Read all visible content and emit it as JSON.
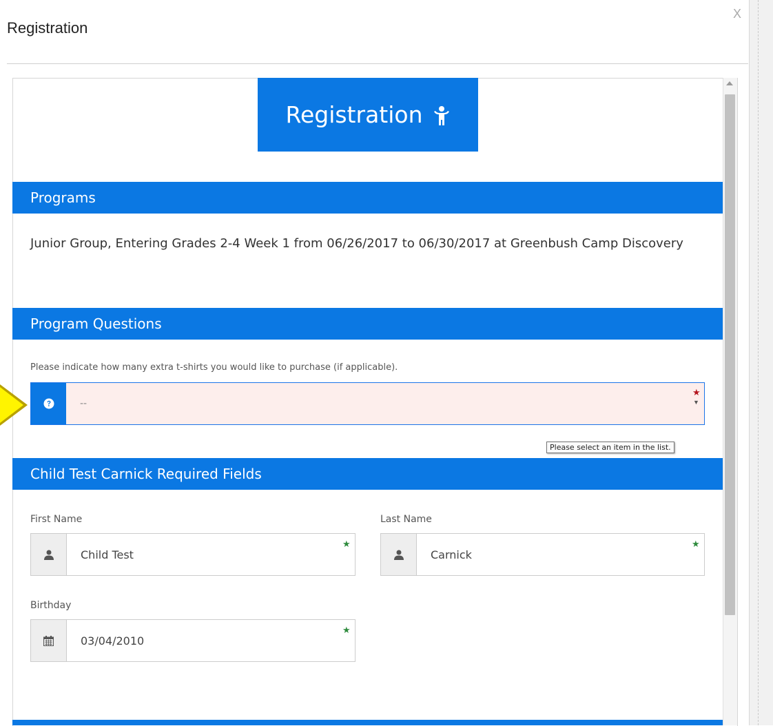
{
  "modal": {
    "title": "Registration",
    "close_label": "X"
  },
  "banner": {
    "title": "Registration",
    "icon": "child-icon"
  },
  "sections": {
    "programs": {
      "title": "Programs",
      "description": "Junior Group, Entering Grades 2-4 Week 1 from 06/26/2017 to 06/30/2017 at Greenbush Camp Discovery"
    },
    "program_questions": {
      "title": "Program Questions",
      "question": "Please indicate how many extra t-shirts you would like to purchase (if applicable).",
      "select_value": "--",
      "icon": "question-circle-icon",
      "validation_tooltip": "Please select an item in the list."
    },
    "required_fields": {
      "title": "Child Test Carnick Required Fields",
      "first_name": {
        "label": "First Name",
        "value": "Child Test",
        "icon": "user-icon"
      },
      "last_name": {
        "label": "Last Name",
        "value": "Carnick",
        "icon": "user-icon"
      },
      "birthday": {
        "label": "Birthday",
        "value": "03/04/2010",
        "icon": "calendar-icon"
      }
    }
  },
  "colors": {
    "brand_blue": "#0b78e3",
    "invalid_background": "#fdeeec",
    "required_green": "#2e8b3d",
    "required_red": "#b4141e",
    "callout_yellow": "#fff400"
  },
  "required_marker": "★"
}
